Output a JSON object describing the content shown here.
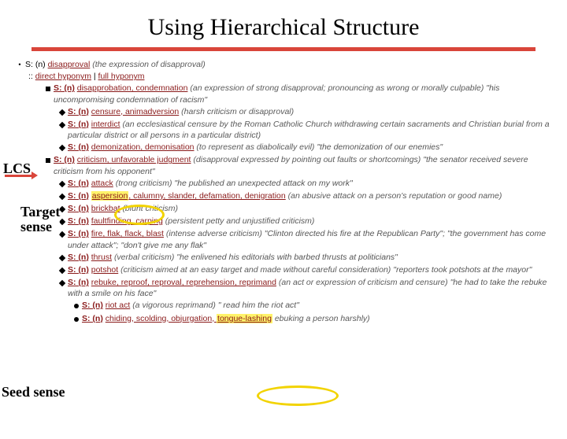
{
  "title": "Using Hierarchical Structure",
  "annotations": {
    "lcs": "LCS",
    "target_line1": "Target",
    "target_line2": "sense",
    "seed": "Seed sense"
  },
  "root": {
    "s": "S: (n)",
    "head": "disapproval",
    "gloss": "(the expression of disapproval)"
  },
  "hyp": {
    "colon": "::",
    "direct": "direct hyponym",
    "sep": "|",
    "full": "full hyponym"
  },
  "entries": {
    "disapprobation": {
      "s": "S: (n)",
      "terms": "disapprobation, condemnation",
      "gloss": "(an expression of strong disapproval; pronouncing as wrong or morally culpable)",
      "quote": "\"his uncompromising condemnation of racism\""
    },
    "censure": {
      "s": "S: (n)",
      "terms": "censure, animadversion",
      "gloss": "(harsh criticism or disapproval)"
    },
    "interdict": {
      "s": "S: (n)",
      "terms": "interdict",
      "gloss": "(an ecclesiastical censure by the Roman Catholic Church withdrawing certain sacraments and Christian burial from a particular district or all persons in a particular district)"
    },
    "demonization": {
      "s": "S: (n)",
      "terms": "demonization, demonisation",
      "gloss": "(to represent as diabolically evil)",
      "quote": "\"the demonization of our enemies\""
    },
    "criticism": {
      "s": "S: (n)",
      "terms": "criticism, unfavorable judgment",
      "gloss": "(disapproval expressed by pointing out faults or shortcomings)",
      "quote": "\"the senator received severe criticism from his opponent\""
    },
    "attack": {
      "s": "S: (n)",
      "head": "attack",
      "gloss_pre": "(",
      "gloss_post": "trong criticism)",
      "quote": "\"he published an unexpected attack on my work\""
    },
    "aspersion": {
      "s": "S: (n)",
      "head": "aspersion",
      "rest": ", calumny, slander, defamation, denigration",
      "gloss": "(an abusive attack on a person's reputation or good name)"
    },
    "brickbat": {
      "s": "S: (n)",
      "terms": "brickbat",
      "gloss": "(blunt criticism)"
    },
    "faultfinding": {
      "s": "S: (n)",
      "terms": "faultfinding, carping",
      "gloss": "(persistent petty and unjustified criticism)"
    },
    "fire": {
      "s": "S: (n)",
      "terms": "fire, flak, flack, blast",
      "gloss": "(intense adverse criticism)",
      "quote": "\"Clinton directed his fire at the Republican Party\"; \"the government has come under attack\"; \"don't give me any flak\""
    },
    "thrust": {
      "s": "S: (n)",
      "terms": "thrust",
      "gloss": "(verbal criticism)",
      "quote": "\"he enlivened his editorials with barbed thrusts at politicians\""
    },
    "potshot": {
      "s": "S: (n)",
      "terms": "potshot",
      "gloss": "(criticism aimed at an easy target and made without careful consideration)",
      "quote": "\"reporters took potshots at the mayor\""
    },
    "rebuke": {
      "s": "S: (n)",
      "terms": "rebuke, reproof, reproval, reprehension, reprimand",
      "gloss": "(an act or expression of criticism and censure)",
      "quote": "\"he had to take the rebuke with a smile on his face\""
    },
    "riotact": {
      "s": "S: (n)",
      "terms": "riot act",
      "gloss": "(a vigorous reprimand)",
      "quote_pre": "\"",
      "quote_mid": " read him ",
      "quote_post": "the riot act\""
    },
    "chiding": {
      "s": "S: (n)",
      "terms_pre": "chiding, scolding, objurgation",
      "terms_hl": "tongue-lashing",
      "gloss_post": "ebuking a person harshly)"
    }
  }
}
